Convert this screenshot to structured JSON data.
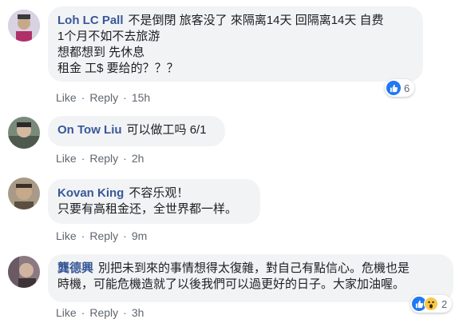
{
  "actions": {
    "like": "Like",
    "reply": "Reply",
    "dot": "·"
  },
  "comments": [
    {
      "name": "Loh LC Pall",
      "lines": [
        "不是倒閉 旅客没了 來隔离14天 回隔离14天 自费",
        "1个月不如不去旅游",
        "想都想到 先休息",
        "租金 工$ 要给的？？？"
      ],
      "time": "15h",
      "reactions": {
        "count": "6",
        "icons": [
          "like-icon"
        ]
      }
    },
    {
      "name": "On Tow Liu",
      "lines": [
        "可以做工吗 6/1"
      ],
      "time": "2h"
    },
    {
      "name": "Kovan King",
      "lines": [
        "不容乐观！",
        "只要有高租金还，全世界都一样。"
      ],
      "time": "9m"
    },
    {
      "name": "龔德興",
      "lines": [
        "別把未到來的事情想得太復雜，對自己有點信心。危機也是",
        "時機，可能危機造就了以後我們可以過更好的日子。大家加油喔。"
      ],
      "time": "3h",
      "reactions": {
        "count": "2",
        "icons": [
          "like-icon",
          "wow-icon"
        ]
      }
    }
  ],
  "colors": {
    "name": "#385898",
    "bubble": "#f2f3f5",
    "meta": "#606770",
    "like": "#2078f4"
  }
}
